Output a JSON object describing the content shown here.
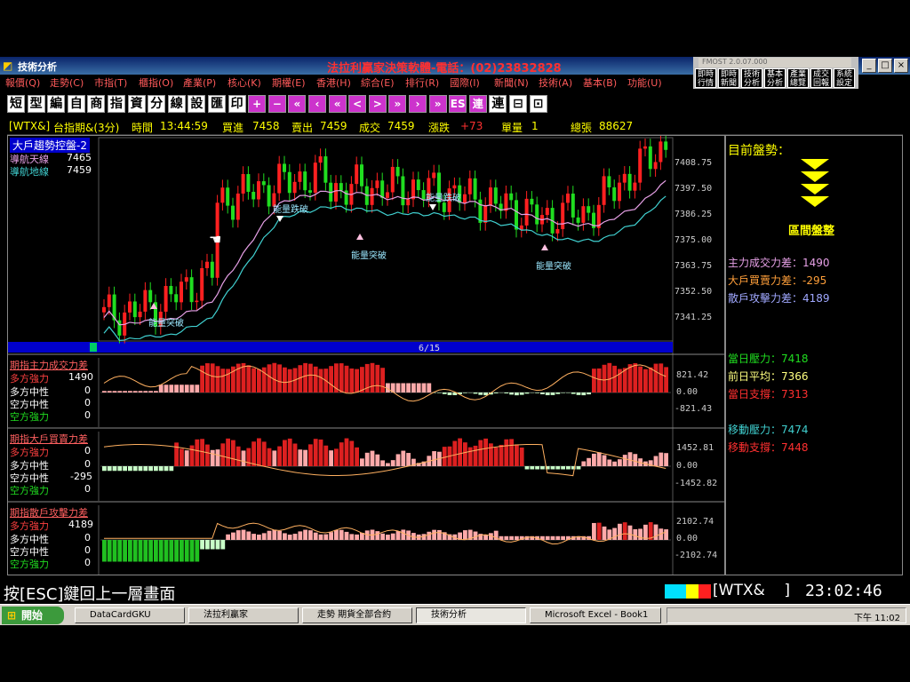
{
  "window": {
    "title": "技術分析",
    "banner": "法拉利贏家決策軟體-電話：(02)23832828",
    "mini_title": "FMOST 2.0.07.000"
  },
  "menu": [
    "報價(Q)",
    "走勢(C)",
    "市指(T)",
    "櫃指(O)",
    "產業(P)",
    "核心(K)",
    "期權(E)",
    "香港(H)",
    "綜合(E)",
    "排行(R)",
    "國際(I)",
    "新聞(N)",
    "技術(A)",
    "基本(B)",
    "功能(U)"
  ],
  "right_buttons": [
    "即時行情",
    "即時新聞",
    "技術分析",
    "基本分析",
    "產業總覽",
    "成交回報",
    "系統設定"
  ],
  "toolbar": [
    "短",
    "型",
    "編",
    "自",
    "商",
    "指",
    "資",
    "分",
    "線",
    "設",
    "匯",
    "印",
    "+",
    "−",
    "«",
    "‹",
    "«",
    "<",
    ">",
    "»",
    "›",
    "»",
    "ES",
    "連",
    "連",
    "⊟",
    "⊡"
  ],
  "info": {
    "code": "[WTX&]",
    "name": "台指期&(3分)",
    "time_label": "時間",
    "time": "13:44:59",
    "buy_label": "買進",
    "buy": "7458",
    "sell_label": "賣出",
    "sell": "7459",
    "deal_label": "成交",
    "deal": "7459",
    "chg_label": "漲跌",
    "chg": "+73",
    "vol_label": "單量",
    "vol": "1",
    "total_label": "總張",
    "total": "88627"
  },
  "main_panel": {
    "title": "大戶趨勢控盤-2",
    "l1_name": "導航天線",
    "l1_val": "7465",
    "l2_name": "導航地線",
    "l2_val": "7459",
    "date": "6/15",
    "y_ticks": [
      "7408.75",
      "7397.50",
      "7386.25",
      "7375.00",
      "7363.75",
      "7352.50",
      "7341.25"
    ],
    "annotations": [
      "能量跌破",
      "能量跌破",
      "能量突破",
      "能量突破",
      "能量突破"
    ]
  },
  "sub1": {
    "title": "期指主力成交力差",
    "rows": [
      [
        "多方強力",
        "1490"
      ],
      [
        "多方中性",
        "0"
      ],
      [
        "空方中性",
        "0"
      ],
      [
        "空方強力",
        "0"
      ]
    ],
    "y_ticks": [
      "821.42",
      "0.00",
      "-821.43"
    ]
  },
  "sub2": {
    "title": "期指大戶買賣力差",
    "rows": [
      [
        "多方強力",
        "0"
      ],
      [
        "多方中性",
        "0"
      ],
      [
        "空方中性",
        "-295"
      ],
      [
        "空方強力",
        "0"
      ]
    ],
    "y_ticks": [
      "1452.81",
      "0.00",
      "-1452.82"
    ]
  },
  "sub3": {
    "title": "期指散戶攻擊力差",
    "rows": [
      [
        "多方強力",
        "4189"
      ],
      [
        "多方中性",
        "0"
      ],
      [
        "空方中性",
        "0"
      ],
      [
        "空方強力",
        "0"
      ]
    ],
    "y_ticks": [
      "2102.74",
      "0.00",
      "-2102.74"
    ]
  },
  "side": {
    "label": "目前盤勢：",
    "state": "區間盤整",
    "l1": "主力成交力差：1490",
    "l2": "大戶買賣力差：-295",
    "l3": "散戶攻擊力差：4189",
    "l4": "當日壓力：7418",
    "l5": "前日平均：7366",
    "l6": "當日支撐：7313",
    "l7": "移動壓力：7474",
    "l8": "移動支撐：7448"
  },
  "status": {
    "hint": "按[ESC]鍵回上一層畫面",
    "code": "[WTX&    ]",
    "clock": "23:02:46"
  },
  "taskbar": {
    "start": "開始",
    "tasks": [
      "DataCardGKU",
      "法拉利贏家",
      "走勢 期貨全部合約",
      "技術分析",
      "Microsoft Excel - Book1"
    ],
    "clock": "下午 11:02"
  },
  "colors": {
    "up": "#ff2020",
    "down": "#20dd20",
    "upper_line": "#e6a0e6",
    "lower_line": "#40d0d0",
    "bar_strong": "#dd2020",
    "bar_weak": "#ffaaaa"
  }
}
